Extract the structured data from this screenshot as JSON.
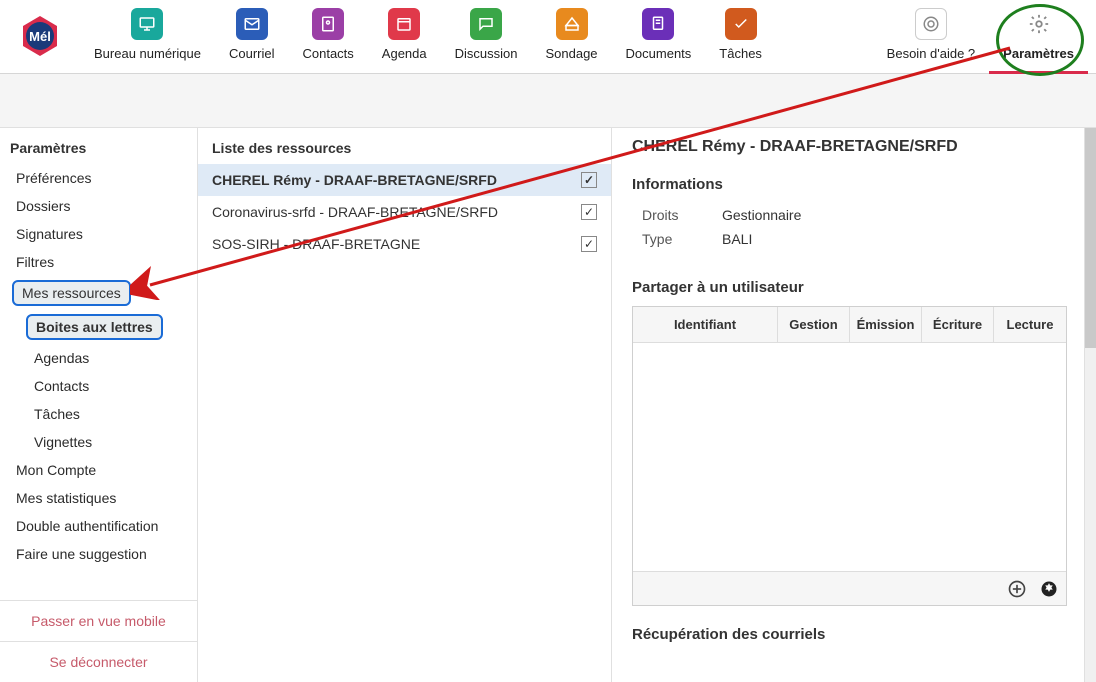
{
  "nav": {
    "items": [
      {
        "label": "Bureau numérique",
        "color": "#19a89c"
      },
      {
        "label": "Courriel",
        "color": "#2b5db8"
      },
      {
        "label": "Contacts",
        "color": "#9b3fa6"
      },
      {
        "label": "Agenda",
        "color": "#e0394a"
      },
      {
        "label": "Discussion",
        "color": "#3aa648"
      },
      {
        "label": "Sondage",
        "color": "#e88a1e"
      },
      {
        "label": "Documents",
        "color": "#6b2fb8"
      },
      {
        "label": "Tâches",
        "color": "#d15a1e"
      }
    ],
    "help": "Besoin d'aide ?",
    "settings": "Paramètres"
  },
  "sidebar": {
    "header": "Paramètres",
    "items": {
      "prefs": "Préférences",
      "dossiers": "Dossiers",
      "signatures": "Signatures",
      "filtres": "Filtres",
      "ressources": "Mes ressources",
      "ressources_sub": {
        "bal": "Boites aux lettres",
        "agendas": "Agendas",
        "contacts": "Contacts",
        "taches": "Tâches",
        "vignettes": "Vignettes"
      },
      "compte": "Mon Compte",
      "stats": "Mes statistiques",
      "auth": "Double authentification",
      "suggestion": "Faire une suggestion"
    },
    "mobile": "Passer en vue mobile",
    "logout": "Se déconnecter"
  },
  "resources": {
    "header": "Liste des ressources",
    "list": [
      {
        "name": "CHEREL Rémy - DRAAF-BRETAGNE/SRFD",
        "checked": true,
        "selected": true
      },
      {
        "name": "Coronavirus-srfd - DRAAF-BRETAGNE/SRFD",
        "checked": true,
        "selected": false
      },
      {
        "name": "SOS-SIRH - DRAAF-BRETAGNE",
        "checked": true,
        "selected": false
      }
    ]
  },
  "detail": {
    "title": "CHEREL Rémy - DRAAF-BRETAGNE/SRFD",
    "info_header": "Informations",
    "droits_label": "Droits",
    "droits_value": "Gestionnaire",
    "type_label": "Type",
    "type_value": "BALI",
    "share_header": "Partager à un utilisateur",
    "share_cols": {
      "id": "Identifiant",
      "gestion": "Gestion",
      "emission": "Émission",
      "ecriture": "Écriture",
      "lecture": "Lecture"
    },
    "recup_header": "Récupération des courriels"
  }
}
